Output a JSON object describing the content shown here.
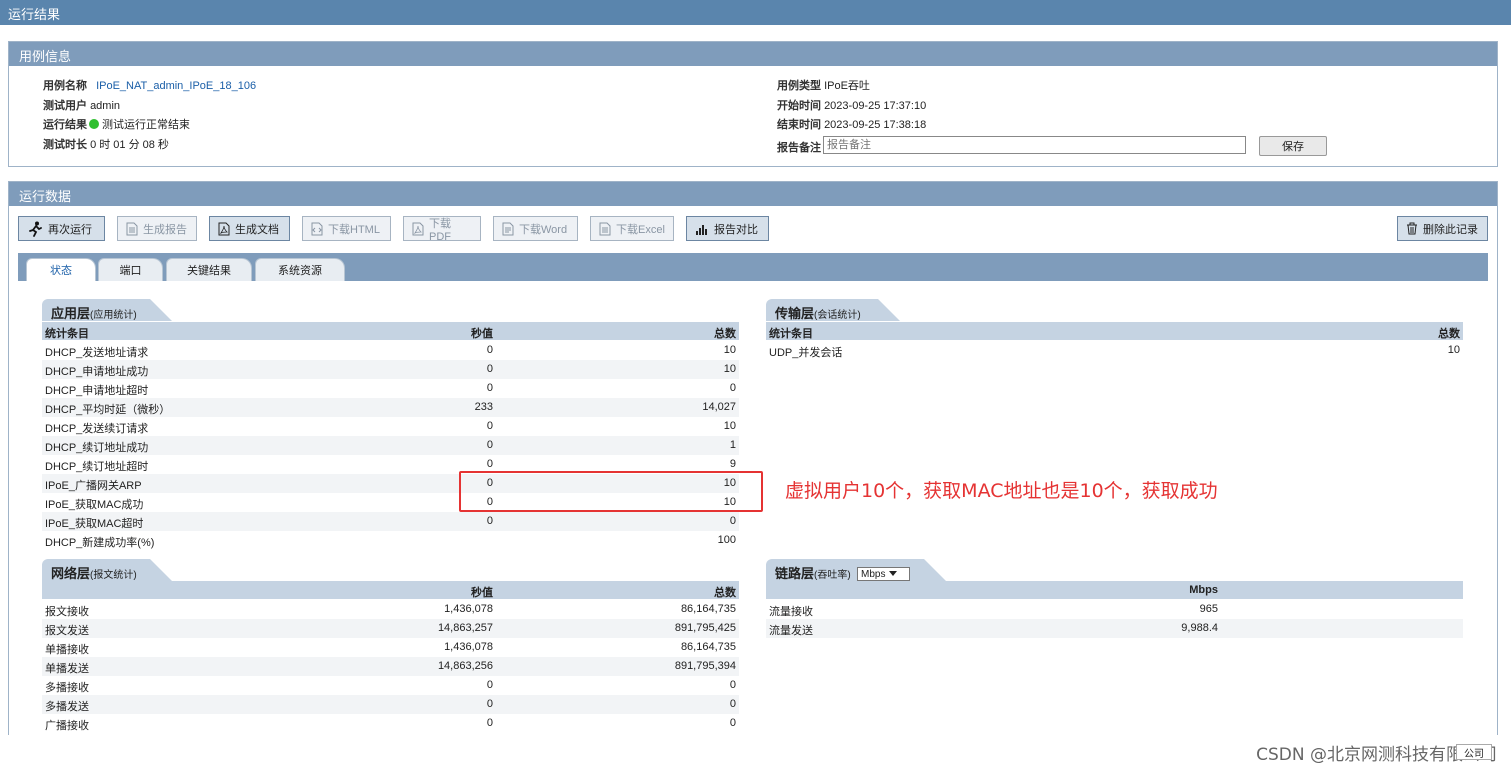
{
  "header": {
    "title": "运行结果"
  },
  "case_panel": {
    "title": "用例信息",
    "case_name_label": "用例名称",
    "case_name": "IPoE_NAT_admin_IPoE_18_106",
    "user_label": "测试用户",
    "user": "admin",
    "result_label": "运行结果",
    "result": "测试运行正常结束",
    "duration_label": "测试时长",
    "duration": "0 时 01 分 08 秒",
    "type_label": "用例类型",
    "type": "IPoE吞吐",
    "start_label": "开始时间",
    "start": "2023-09-25 17:37:10",
    "end_label": "结束时间",
    "end": "2023-09-25 17:38:18",
    "note_label": "报告备注",
    "note_placeholder": "报告备注",
    "save_label": "保存"
  },
  "data_panel": {
    "title": "运行数据",
    "toolbar": {
      "rerun": "再次运行",
      "gen_report": "生成报告",
      "gen_doc": "生成文档",
      "dl_html": "下载HTML",
      "dl_pdf": "下载PDF",
      "dl_word": "下载Word",
      "dl_excel": "下载Excel",
      "compare": "报告对比",
      "delete": "删除此记录"
    },
    "tabs": [
      "状态",
      "端口",
      "关键结果",
      "系统资源"
    ]
  },
  "app_layer": {
    "title": "应用层",
    "subtitle": "(应用统计)",
    "headers": [
      "统计条目",
      "秒值",
      "总数"
    ],
    "rows": [
      [
        "DHCP_发送地址请求",
        "0",
        "10"
      ],
      [
        "DHCP_申请地址成功",
        "0",
        "10"
      ],
      [
        "DHCP_申请地址超时",
        "0",
        "0"
      ],
      [
        "DHCP_平均时延（微秒）",
        "233",
        "14,027"
      ],
      [
        "DHCP_发送续订请求",
        "0",
        "10"
      ],
      [
        "DHCP_续订地址成功",
        "0",
        "1"
      ],
      [
        "DHCP_续订地址超时",
        "0",
        "9"
      ],
      [
        "IPoE_广播网关ARP",
        "0",
        "10"
      ],
      [
        "IPoE_获取MAC成功",
        "0",
        "10"
      ],
      [
        "IPoE_获取MAC超时",
        "0",
        "0"
      ],
      [
        "DHCP_新建成功率(%)",
        "",
        "100"
      ]
    ]
  },
  "transport_layer": {
    "title": "传输层",
    "subtitle": "(会话统计)",
    "headers": [
      "统计条目",
      "总数"
    ],
    "rows": [
      [
        "UDP_并发会话",
        "10"
      ]
    ]
  },
  "network_layer": {
    "title": "网络层",
    "subtitle": "(报文统计)",
    "headers": [
      "",
      "秒值",
      "总数"
    ],
    "rows": [
      [
        "报文接收",
        "1,436,078",
        "86,164,735"
      ],
      [
        "报文发送",
        "14,863,257",
        "891,795,425"
      ],
      [
        "单播接收",
        "1,436,078",
        "86,164,735"
      ],
      [
        "单播发送",
        "14,863,256",
        "891,795,394"
      ],
      [
        "多播接收",
        "0",
        "0"
      ],
      [
        "多播发送",
        "0",
        "0"
      ],
      [
        "广播接收",
        "0",
        "0"
      ]
    ]
  },
  "link_layer": {
    "title": "链路层",
    "subtitle": "(吞吐率)",
    "unit_select": "Mbps",
    "headers": [
      "",
      "Mbps"
    ],
    "rows": [
      [
        "流量接收",
        "965"
      ],
      [
        "流量发送",
        "9,988.4"
      ]
    ]
  },
  "annotation": {
    "text": "虚拟用户10个，获取MAC地址也是10个，获取成功",
    "color": "#e53333"
  },
  "watermark": "CSDN @北京网测科技有限公司",
  "fold_label": "公司",
  "colors": {
    "header_bg": "#5a85ad",
    "panel_head": "#7f9cbb",
    "section_tab": "#c5d3e2",
    "status_ok": "#2fbf2f"
  }
}
